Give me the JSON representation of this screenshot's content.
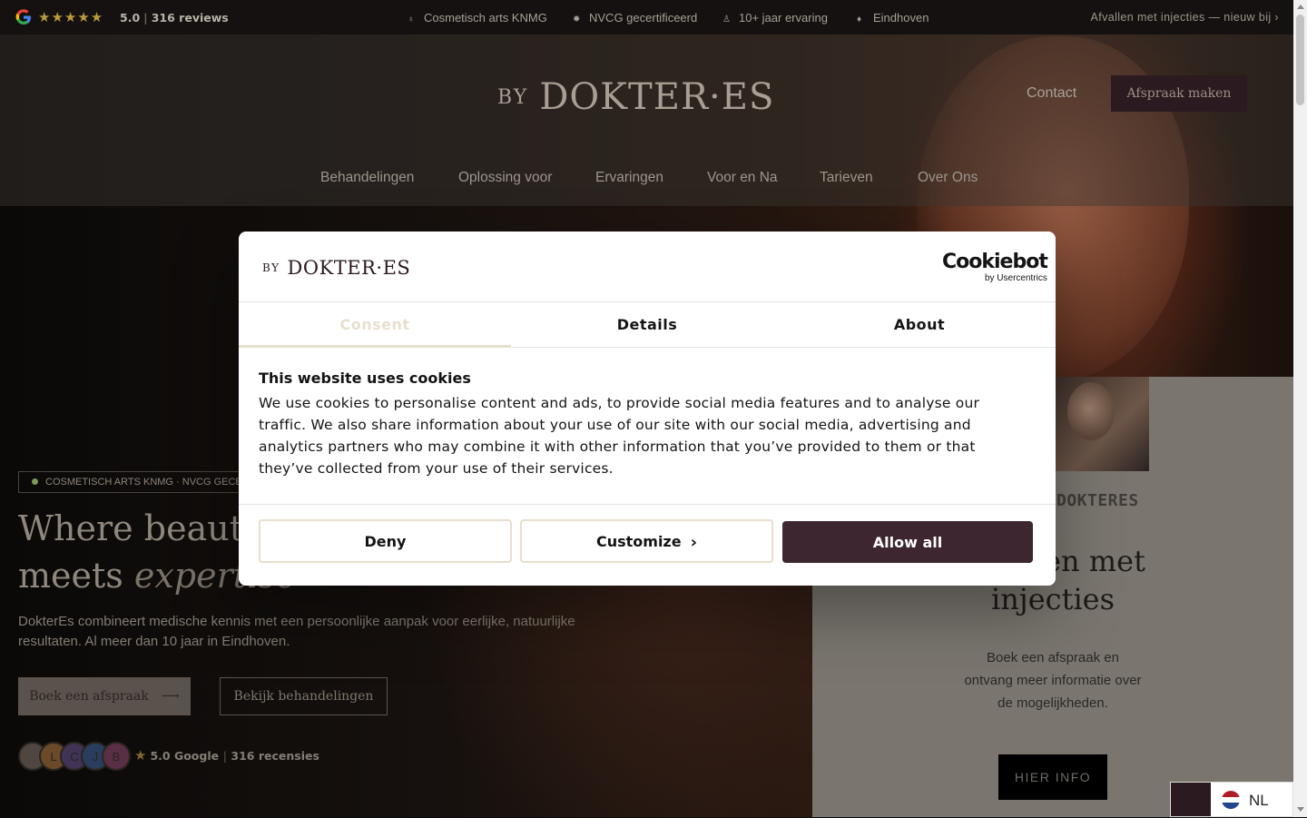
{
  "topbar": {
    "rating_value": "5.0",
    "reviews": "316 reviews",
    "separator": "|",
    "trust_items": [
      {
        "label": "Cosmetisch arts KNMG",
        "icon": "stethoscope-icon"
      },
      {
        "label": "NVCG gecertificeerd",
        "icon": "badge-icon"
      },
      {
        "label": "10+ jaar ervaring",
        "icon": "medal-icon"
      },
      {
        "label": "Eindhoven",
        "icon": "location-pin-icon"
      }
    ],
    "promo": "Afvallen met injecties — nieuw bij ›"
  },
  "header": {
    "logo_by": "BY",
    "logo_name": "DOKTER·ES",
    "contact": "Contact",
    "cta": "Afspraak maken",
    "nav": [
      "Behandelingen",
      "Oplossing voor",
      "Ervaringen",
      "Voor en Na",
      "Tarieven",
      "Over Ons"
    ]
  },
  "hero": {
    "badge": "COSMETISCH ARTS KNMG · NVCG GECERTIFICEERD",
    "title_line1": "Where beauty",
    "title_line2_prefix": "meets ",
    "title_line2_em": "expertise",
    "lead": "DokterEs combineert medische kennis met een persoonlijke aanpak voor eerlijke, natuurlijke resultaten. Al meer dan 10 jaar in Eindhoven.",
    "primary_button": "Boek een afspraak",
    "secondary_button": "Bekijk behandelingen",
    "avatars": [
      "",
      "L",
      "C",
      "J",
      "B"
    ],
    "social_rating": "5.0 Google",
    "social_sep": "|",
    "social_reviews": "316 recensies"
  },
  "promo_panel": {
    "brand": "DOKTERES",
    "title_line1": "Afvallen met",
    "title_line2": "injecties",
    "text": "Boek een afspraak en ontvang meer informatie over de mogelijkheden.",
    "button": "HIER INFO"
  },
  "language": {
    "code": "NL"
  },
  "cookie_dialog": {
    "logo_by": "BY",
    "logo_name": "DOKTER·ES",
    "provider": "Cookiebot",
    "provider_sub": "by Usercentrics",
    "tabs": [
      "Consent",
      "Details",
      "About"
    ],
    "active_tab": "Consent",
    "heading": "This website uses cookies",
    "body": "We use cookies to personalise content and ads, to provide social media features and to analyse our traffic. We also share information about your use of our site with our social media, advertising and analytics partners who may combine it with other information that you’ve provided to them or that they’ve collected from your use of their services.",
    "deny": "Deny",
    "customize": "Customize",
    "allow_all": "Allow all"
  },
  "colors": {
    "brand_plum": "#3d2630",
    "accent_beige": "#e7dfcf",
    "star_gold": "#b99a3c"
  }
}
